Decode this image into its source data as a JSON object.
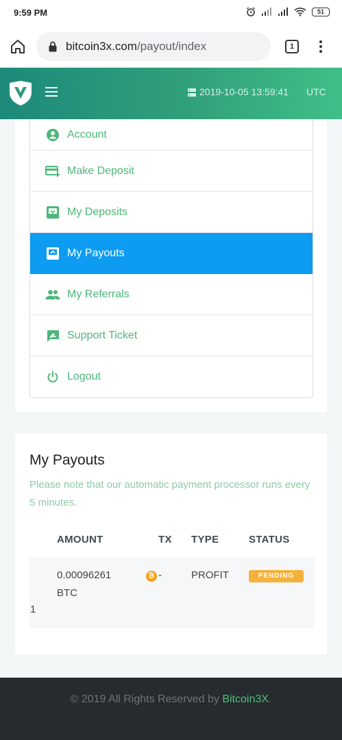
{
  "status_bar": {
    "time": "9:59 PM",
    "battery": "51"
  },
  "browser": {
    "url_domain": "bitcoin3x.com",
    "url_path": "/payout/index",
    "tab_count": "1"
  },
  "header": {
    "datetime": "2019-10-05 13:59:41",
    "timezone": "UTC"
  },
  "menu": {
    "items": [
      {
        "label": "Account",
        "icon": "account-circle-icon"
      },
      {
        "label": "Make Deposit",
        "icon": "credit-card-plus-icon"
      },
      {
        "label": "My Deposits",
        "icon": "inbox-down-icon"
      },
      {
        "label": "My Payouts",
        "icon": "inbox-up-icon",
        "active": true
      },
      {
        "label": "My Referrals",
        "icon": "people-icon"
      },
      {
        "label": "Support Ticket",
        "icon": "chat-edit-icon"
      },
      {
        "label": "Logout",
        "icon": "power-icon"
      }
    ]
  },
  "payouts": {
    "title": "My Payouts",
    "note": "Please note that our automatic payment processor runs every 5 minutes.",
    "columns": {
      "amount": "AMOUNT",
      "tx": "TX",
      "type": "TYPE",
      "status": "STATUS"
    },
    "rows": [
      {
        "date_fragment": ")1",
        "amount": "0.00096261",
        "currency": "BTC",
        "coin_symbol": "₿",
        "tx": "-",
        "type": "PROFIT",
        "status": "PENDING"
      }
    ]
  },
  "footer": {
    "copyright": "© 2019 All Rights Reserved by ",
    "brand": "Bitcoin3X",
    "end": "."
  },
  "colors": {
    "accent_green": "#4cb779",
    "active_blue": "#0d9cf2",
    "pending_badge": "#f4b13c",
    "footer_bg": "#272b30"
  }
}
